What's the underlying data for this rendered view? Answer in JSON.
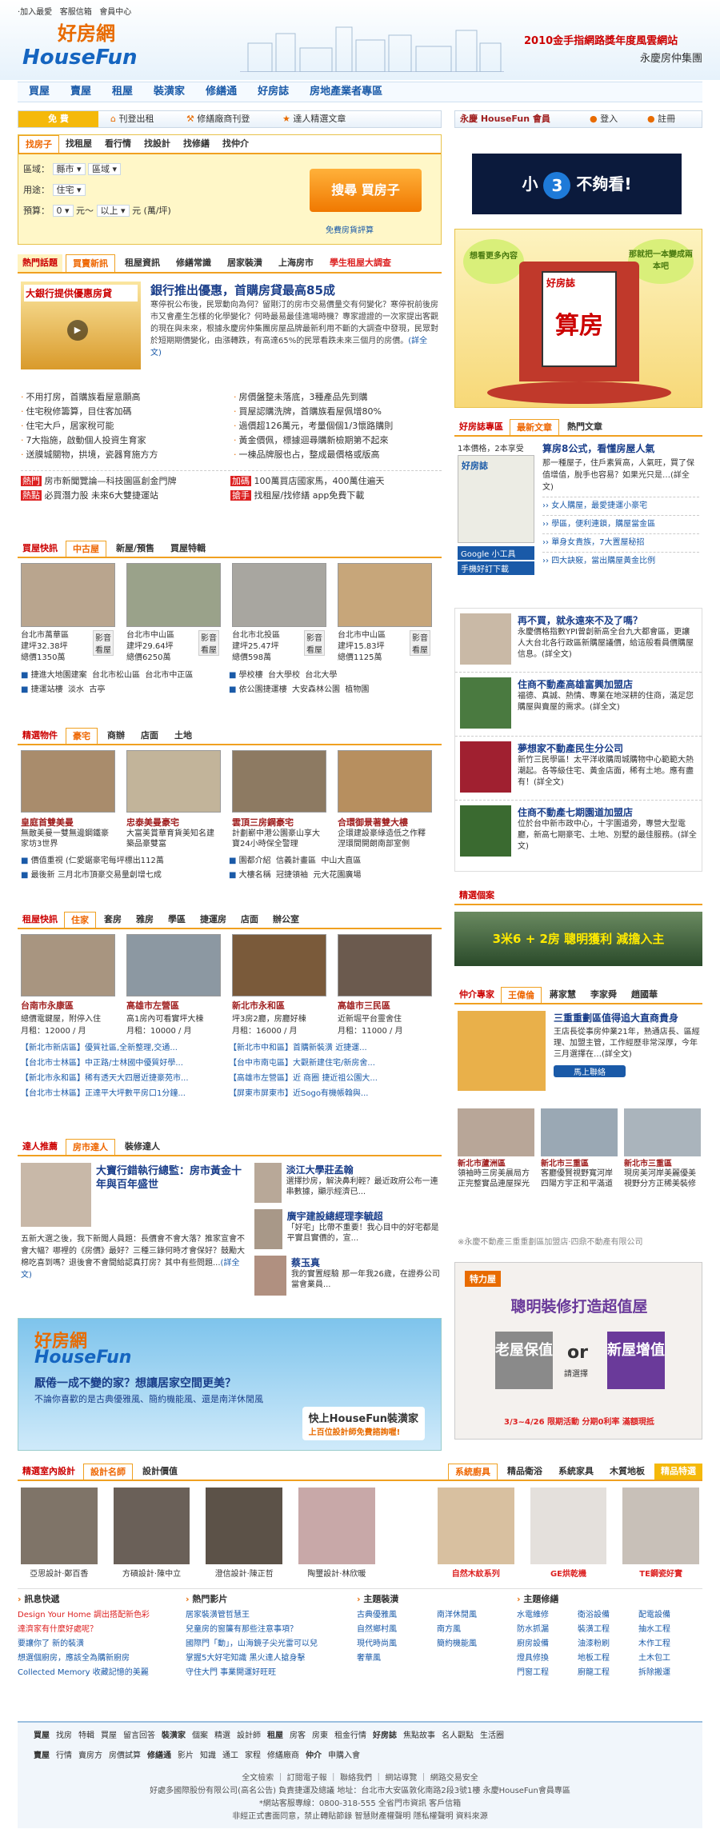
{
  "top": {
    "links": [
      "‧加入最愛",
      "客服信箱",
      "會員中心"
    ],
    "logo_cn": "好房網",
    "logo_en": "HouseFun",
    "award": "2010金手指網路獎年度風雲網站",
    "group": "永慶房仲集團"
  },
  "nav": [
    "買屋",
    "賣屋",
    "租屋",
    "裝潢家",
    "修繕通",
    "好房誌",
    "房地產業者專區"
  ],
  "free_bar": {
    "label": "免 費",
    "items": [
      "刊登出租",
      "修繕廠商刊登",
      "達人精選文章"
    ]
  },
  "member": {
    "title": "永慶 HouseFun 會員",
    "login": "登入",
    "register": "註冊"
  },
  "search": {
    "tabs": [
      "找房子",
      "找租屋",
      "看行情",
      "找設計",
      "找修繕",
      "找仲介"
    ],
    "region_label": "區域：",
    "city": "縣市",
    "district": "區域",
    "use_label": "用途：",
    "use": "住宅",
    "budget_label": "預算：",
    "min": "0",
    "unit1": "元～",
    "max": "以上",
    "unit2": "元 (萬/坪)",
    "button": "搜尋 買房子",
    "free_watch": "免費房貨評算"
  },
  "ad1": {
    "text1": "小",
    "num": "3",
    "text2": "不夠看!"
  },
  "ad2": {
    "bubble1": "想看更多內容",
    "bubble2": "那就把一本變成兩本吧",
    "mag": "好房誌",
    "title": "算房"
  },
  "hot": {
    "label": "熱門話題",
    "tabs": [
      "買賣新訊",
      "租屋資訊",
      "修繕常識",
      "居家裝潢",
      "上海房市",
      "學生租屋大調查"
    ],
    "img_caption": "大銀行提供優惠房貸",
    "headline": "銀行推出優惠，首購房貸最高85成",
    "body": "寒停祝公布後，民眾動向為何？留剛汀的房市交易價量交有何變化？寒停祝前後房市又會產生怎樣的化學變化？何時最易最佳進場時機？專家證證的一次家提出客觀的現在與未來，根據永慶房仲集團房屋品牌最新利用不斷的大調查中發現，民眾對於短期期價變化，由漲轉跌，有高達65%的民眾看跌未來三個月的房價。",
    "more": "(詳全文)",
    "list_left": [
      "不用打房，首購族看屋意願高",
      "住宅稅修籌算，目住客加碼",
      "住宅大戶，居家稅可能",
      "7大指施，啟動個人投資生育家",
      "送膜城關物，拱境，瓷器育施方方"
    ],
    "list_right": [
      "房價盤整未落底，3種產品先到購",
      "買屋認購洗牌，首購族看屋佩增80%",
      "過價超126萬元，考量個個1/3懷路購則",
      "黃金價佩，標據迴尋購新檢期第不起來",
      "一棟品牌服也占，整成最價格或版高"
    ],
    "promos": [
      [
        "熱門",
        "房市新聞覽論—科技園區創金門牌"
      ],
      [
        "加碼",
        "100萬買店國家馬，400萬住遍天"
      ],
      [
        "熱點",
        "必買潛力股 未來6大雙捷運站"
      ],
      [
        "搶手",
        "找租屋/找修繕 app免費下載"
      ]
    ]
  },
  "buy": {
    "label": "買屋快訊",
    "tabs": [
      "中古屋",
      "新屋/預售",
      "買屋特輯"
    ],
    "items": [
      {
        "loc": "台北市萬華區",
        "price_sqm": "建坪32.38坪",
        "total": "總價1350萬"
      },
      {
        "loc": "台北市中山區",
        "price_sqm": "建坪29.64坪",
        "total": "總價6250萬"
      },
      {
        "loc": "台北市北投區",
        "price_sqm": "建坪25.47坪",
        "total": "總價598萬"
      },
      {
        "loc": "台北市中山區",
        "price_sqm": "建坪15.83坪",
        "total": "總價1125萬"
      }
    ],
    "badge": "影音看屋",
    "links": [
      [
        "捷進大地園建案",
        "台北市松山區",
        "台北市中正區"
      ],
      [
        "學校樓",
        "台大學校",
        "台北大學"
      ],
      [
        "捷運站樓",
        "淡水",
        "古亭"
      ],
      [
        "依公園捷運樓",
        "大安森林公園",
        "植物園"
      ]
    ]
  },
  "feat": {
    "label": "精選物件",
    "tabs": [
      "豪宅",
      "商辦",
      "店面",
      "土地"
    ],
    "items": [
      {
        "title": "皇庭首雙美曼",
        "desc": "無敵美曼一雙無邊鋼鐵豪家坊3世界"
      },
      {
        "title": "忠泰美曼豪宅",
        "desc": "大富美賞華育貨美知名建築品豪雙富"
      },
      {
        "title": "雲頂三房鋼豪宅",
        "desc": "計劃嶄中港公園豪山享大寶24小時保全警理"
      },
      {
        "title": "合環御景著雙大樓",
        "desc": "企環建設豪綠造低之作釋涅環間開朗南部室側"
      }
    ],
    "links": [
      [
        "價值重視",
        "(仁愛鋸豪宅每坪標出112萬"
      ],
      [
        "園都介紹",
        "信義計畫區",
        "中山大直區"
      ],
      [
        "最後新",
        "三月北市頂豪交易量創增七成"
      ],
      [
        "大樓名稱",
        "冠捷領袖",
        "元大花園廣場"
      ]
    ]
  },
  "rent": {
    "label": "租屋快訊",
    "tabs": [
      "住家",
      "套房",
      "雅房",
      "學區",
      "捷運房",
      "店面",
      "辦公室"
    ],
    "items": [
      {
        "loc": "台南市永康區",
        "rent": "月租：12000 / 月"
      },
      {
        "loc": "高雄市左營區",
        "rent": "月租：10000 / 月"
      },
      {
        "loc": "新北市永和區",
        "rent": "月租：16000 / 月"
      },
      {
        "loc": "高雄市三民區",
        "rent": "月租：11000 / 月"
      }
    ],
    "descs": [
      "總價電鍵屋，附停入住",
      "高1房內可看實坪大棟",
      "坪3房2廳，房廳好棟",
      "近新堀平台靈舍住"
    ],
    "links": [
      "【新北市新店區】優質社區,全新整理,交通...",
      "【新北市中和區】首購新裝潢 近捷運...",
      "【台北市士林區】中正路/士林國中優質好學...",
      "【台中市南屯區】大觀新建住宅/新房舍...",
      "【新北市永和區】稀有透天大四層近捷豪苑市...",
      "【高雄市左營區】近 商圈 捷近祖公園大...",
      "【台北市士林區】正達平大坪數平房口1分鐘...",
      "【屏東市屏東市】近Sogo有機帳翰與..."
    ]
  },
  "expert": {
    "label": "達人推薦",
    "tabs": [
      "房市達人",
      "裝修達人"
    ],
    "headline": "大寶行錯執行總監：房市黃金十年與百年盛世",
    "body": "五新大選之後，我下新聞人員題：長價會不會大落？推家宣會不會大幅？哪裡的《房價》最好？三種三錄何時才會保好？鼓勵大棉吃喜到嗎？退後會不會間給認真打房？其中有些問題...",
    "more": "(詳全文)",
    "people": [
      {
        "name": "淡江大學莊孟翰",
        "text": "選擇抄房，解決鼻利輕？最近政府公布一連串數據，顯示經濟已..."
      },
      {
        "name": "廣宇建設總經理李毓超",
        "text": "「好宅」比帶不重要！我心目中的好宅都是平實且實價的，宣..."
      },
      {
        "name": "蔡玉真",
        "text": "我的實置經驗 那一年我26歲，在證券公司當會業員..."
      }
    ]
  },
  "bigad": {
    "title": "厭倦一成不變的家？想讓居家空間更美？",
    "sub": "不論你喜歡的是古典優雅風、簡約機能風、還是南洋休閒風",
    "cta": "快上HouseFun裝潢家",
    "cta2": "上百位設計師免費諮詢喔!"
  },
  "design": {
    "label": "精選室內設計",
    "tabs": [
      "設計名師",
      "設計價值"
    ],
    "tabs2": [
      "系統廚具",
      "精品衛浴",
      "系統家具",
      "木質地板"
    ],
    "label2": "精品特選",
    "designers": [
      "亞思設計‧鄭百香",
      "方碩設計‧陳中立",
      "澄信設計‧陳正哲",
      "陶璽設計‧林欣暖"
    ],
    "products": [
      "自然木紋系列",
      "GE烘乾機",
      "TE鋼瓷好實"
    ]
  },
  "bottom_lists": [
    {
      "title": "訊息快遞",
      "items": [
        "Design Your Home 調出搭配新色彩",
        "達濟家有什麼好處呢？",
        "要讓你了  新的裝潢",
        "想選個廚房，應該全為購新廚房",
        "Collected Memory 收藏記憶的美麗"
      ]
    },
    {
      "title": "熱門影片",
      "items": [
        "居家裝潢管哲慧王",
        "兒童房的窗簾有那些注意事項？",
        "國際門「動」，山海鏡子尖光雷可以兒",
        "掌握5大好宅知識 黑火達人搶身擊",
        "守住大門 事業開運好旺旺"
      ]
    },
    {
      "title": "主題裝潢",
      "items": [
        "古典優雅風",
        "南洋休閒風",
        "自然鄉村風",
        "南方風",
        "現代時尚風",
        "簡約機能風",
        "奢華風"
      ]
    },
    {
      "title": "主題修繕",
      "items": [
        "水電維修",
        "衛浴設備",
        "配電設備",
        "防水抓漏",
        "裝潢工程",
        "抽水工程",
        "廚房設備",
        "油漆粉刷",
        "木作工程",
        "燈具修換",
        "地板工程",
        "土木包工",
        "門窗工程",
        "廚龍工程",
        "拆除搬運"
      ]
    }
  ],
  "right": {
    "mag_tabs": [
      "好房誌專區",
      "最新文章",
      "熱門文章"
    ],
    "mag_promo1": "1本價格，2本享受",
    "mag_promo2": "好房誌",
    "mag_title": "算房8公式，看懂房屋人氣",
    "mag_body": "那一種屋子，住戶素質高，人氣旺，買了保值增值，脫手也容易？如果光只是…(詳全文)",
    "mag_links": [
      "女人購屋，最愛捷運小豪宅",
      "學區，便利連鎖，購屋當金區",
      "單身女貴族，7大置屋秘招",
      "四大訣竅，當出購屋黃金比例"
    ],
    "google": "Google 小工具",
    "ipad": "手機好訂下載",
    "news": [
      {
        "title": "再不買，就永遠來不及了嗎？",
        "body": "永慶價格指數YPI曾創新高全台九大都會區，更讓人大台北各行政區新購屋議價，給這般看員價購屋信息。(詳全文)"
      },
      {
        "title": "住商不動產高雄富興加盟店",
        "body": "福德、真誠、熱情、專業在地深耕的住商，滿足您購屋與賣屋的需求。(詳全文)"
      },
      {
        "title": "夢想家不動產民生分公司",
        "body": "新竹三民學區！太平洋收購周城購物中心範範大熱潮起。各等級住宅、黃金店面，稀有土地。應有盡有！(詳全文)"
      },
      {
        "title": "住商不動產七期園道加盟店",
        "body": "位於台中新市政中心，十字園道旁，專營大型電廳，新高七期豪宅、土地、別墅的最佳服務。(詳全文)"
      }
    ],
    "feature_label": "精選個案",
    "feature_banner": "3米6 + 2房 聰明獲利 減擔入主",
    "agent_label": "仲介專家",
    "agent_tabs": [
      "王偉倫",
      "蔣家慧",
      "李家舜",
      "趙國華"
    ],
    "agent_title": "三重重劃區值得追大直商貴身",
    "agent_body": "王店長從事房仲業21年，熟通店長、區經理、加盟主管，工作經歷非常深厚，今年三月選擇在…(詳全文)",
    "agent_contact": "馬上聯絡",
    "agent_props": [
      {
        "loc": "新北市蘆洲區",
        "desc": "領袖時三房美晨局方正完整實品連屋探光"
      },
      {
        "loc": "新北市三重區",
        "desc": "客廳優賢視野寬河岸四陽方宇正和平滿道"
      },
      {
        "loc": "新北市三重區",
        "desc": "現房美河岸美麗優美視野分方正稀美裝修"
      }
    ],
    "agent_note": "※永慶不動產三重重劃區加盟店‧四鼎不動產有限公司",
    "reno_brand": "特力屋",
    "reno_title": "聰明裝修打造超值屋",
    "old": "老屋保值",
    "or": "or",
    "ask": "請選擇",
    "new": "新屋增值",
    "date": "3/3~4/26 限期活動 分期0利率 滿額現抵"
  },
  "footer": {
    "links1": [
      "買屋",
      "找房",
      "特輯",
      "買屋",
      "留言回答",
      "裝潢家",
      "個案",
      "精選",
      "設計師",
      "租屋",
      "房客",
      "房東",
      "租金行情",
      "好房誌",
      "焦點故事",
      "名人觀點",
      "生活圈"
    ],
    "links2": [
      "賣屋",
      "行情",
      "賣房方",
      "房價試算",
      "修繕通",
      "影片",
      "知識",
      "通工",
      "家程",
      "修繕廠商",
      "仲介",
      "申購入會"
    ],
    "mid": "全文檢索 ｜ 訂閱電子報 ｜ 聯絡我們 ｜ 網站導覽 ｜ 網路交易安全",
    "company": "好處多國際股份有限公司(高名公告) 負責捷運及總議 地址：台北市大安區敦化南路2段3號1樓 永慶HouseFun會員專區",
    "contact": "*網站客服專線：0800-318-555 全省門市資訊 客戶信箱",
    "copyright": "非經正式書面同意，禁止轉貼節錄 智慧財產權聲明 隱私權聲明 資料來源"
  }
}
